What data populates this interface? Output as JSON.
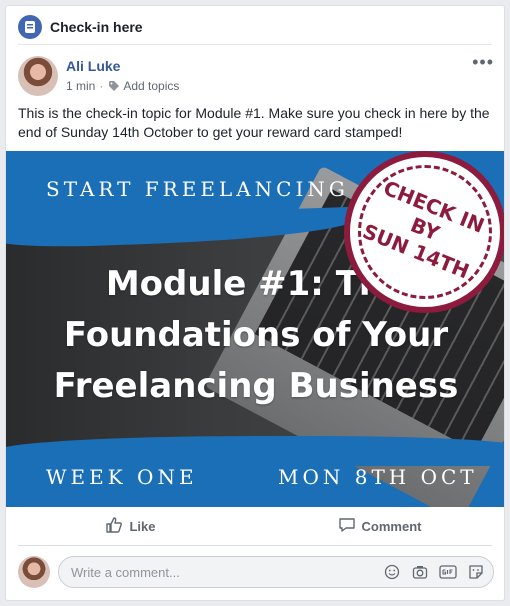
{
  "header": {
    "title": "Check-in here",
    "icon": "topic-icon"
  },
  "post": {
    "author": "Ali Luke",
    "time": "1 min",
    "separator": "·",
    "topics_label": "Add topics",
    "text": "This is the check-in topic for Module #1. Make sure you check in here by the end of Sunday 14th October to get your reward card stamped!",
    "more": "•••"
  },
  "image": {
    "top_text": "START FREELANCING",
    "title": "Module #1: The Foundations of Your Freelancing Business",
    "week": "WEEK ONE",
    "date": "MON 8TH OCT",
    "stamp_line1": "CHECK IN",
    "stamp_line2": "BY",
    "stamp_line3": "SUN 14TH",
    "colors": {
      "background": "#1b6fb6",
      "stamp": "#8c1b3e"
    }
  },
  "actions": {
    "like_label": "Like",
    "comment_label": "Comment"
  },
  "comment": {
    "placeholder": "Write a comment...",
    "value": ""
  },
  "colors": {
    "link": "#365899",
    "accent": "#4267b2"
  }
}
